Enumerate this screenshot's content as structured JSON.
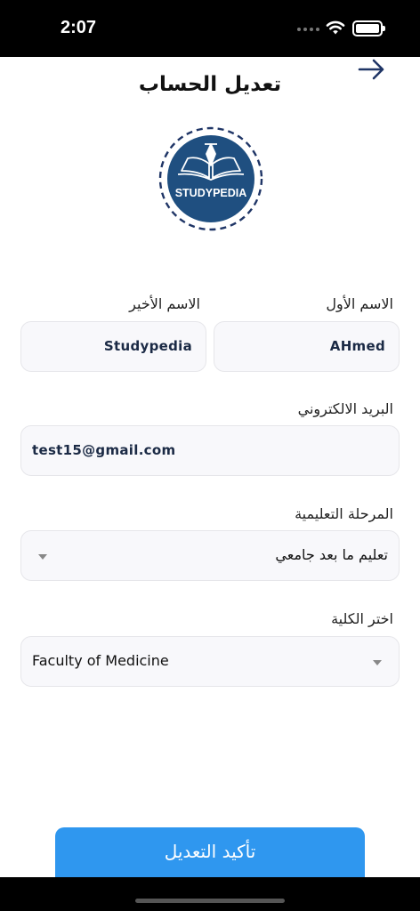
{
  "status_bar": {
    "time": "2:07"
  },
  "header": {
    "title": "تعديل الحساب"
  },
  "logo": {
    "text": "STUDYPEDIA"
  },
  "form": {
    "first_name": {
      "label": "الاسم الأول",
      "value": "AHmed"
    },
    "last_name": {
      "label": "الاسم الأخير",
      "value": "Studypedia"
    },
    "email": {
      "label": "البريد الالكتروني",
      "value": "test15@gmail.com"
    },
    "education_stage": {
      "label": "المرحلة التعليمية",
      "selected": "تعليم ما بعد جامعي"
    },
    "faculty": {
      "label": "اختر الكلية",
      "selected": "Faculty of Medicine"
    }
  },
  "actions": {
    "confirm_label": "تأكيد التعديل"
  },
  "colors": {
    "primary": "#2f97ef",
    "logo_navy": "#1f4f80",
    "text_dark": "#1b2a45"
  }
}
